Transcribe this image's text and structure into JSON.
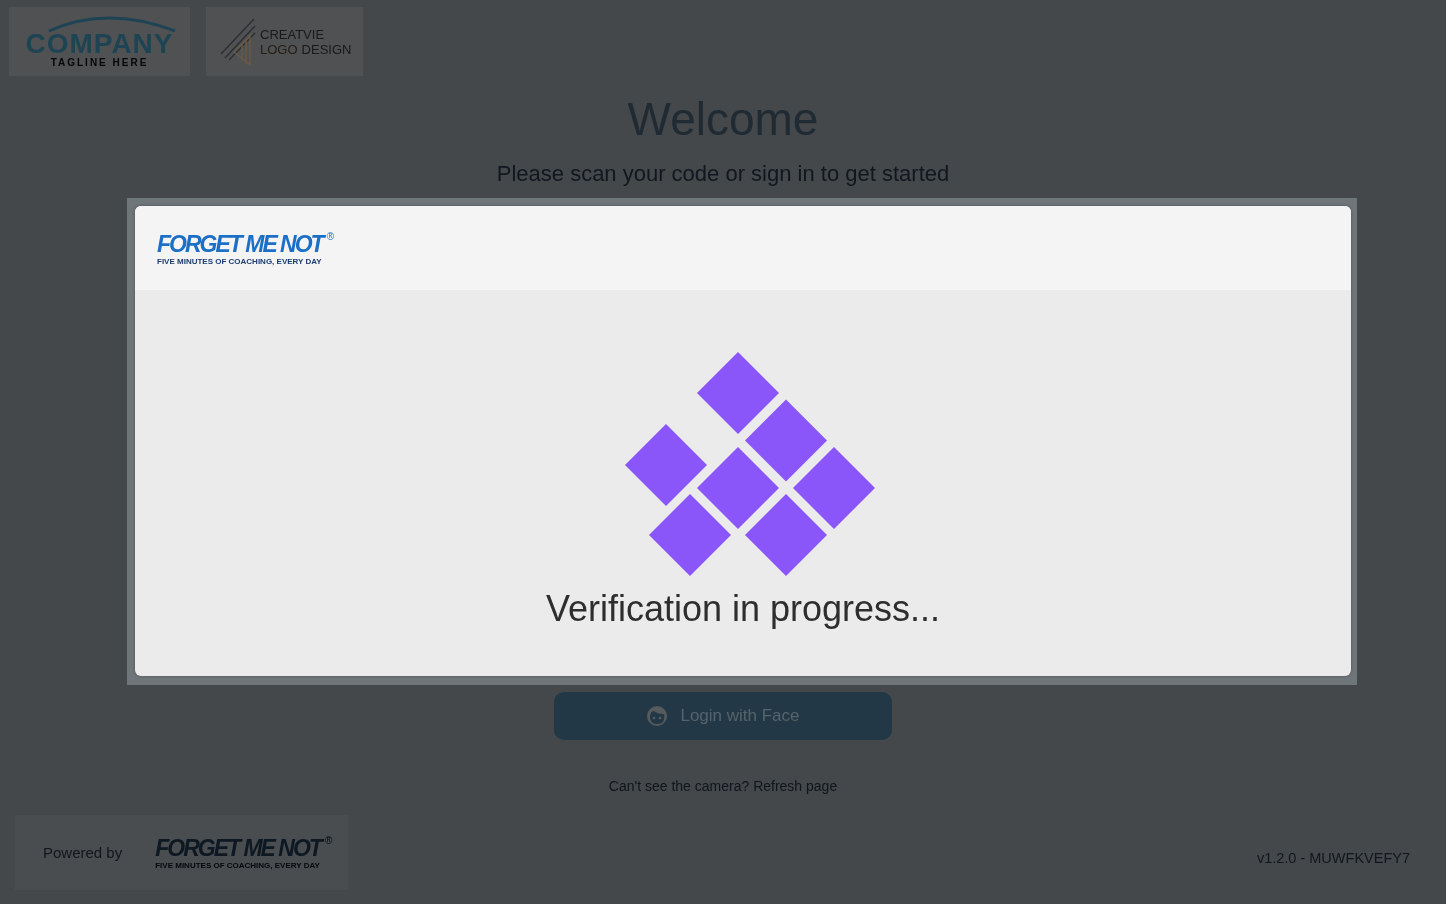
{
  "company_logo": {
    "wordmark": "COMPANY",
    "tagline": "TAGLINE HERE"
  },
  "design_logo": {
    "line_1": "CREATVIE",
    "line_2_accent": "LOGO",
    "line_2_rest": "DESIGN"
  },
  "heading": "Welcome",
  "subheading": "Please scan your code or sign in to get started",
  "dialog": {
    "logo": {
      "wordmark": "FORGET ME NOT",
      "registered_mark": "®",
      "tagline": "FIVE MINUTES OF COACHING, EVERY DAY"
    },
    "status": "Verification in progress..."
  },
  "login_button": "Login with Face",
  "camera_hint": {
    "text": "Can't see the camera?",
    "link": "Refresh page"
  },
  "footer": {
    "powered_by": "Powered by",
    "logo": {
      "wordmark": "FORGET ME NOT",
      "registered_mark": "®",
      "tagline": "FIVE MINUTES OF COACHING, EVERY DAY"
    },
    "version": "v1.2.0 - MUWFKVEFY7"
  }
}
